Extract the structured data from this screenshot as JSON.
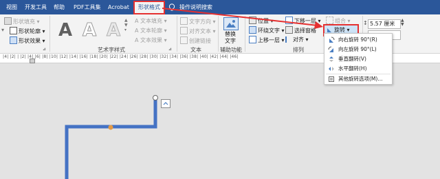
{
  "tabs": [
    "视图",
    "开发工具",
    "帮助",
    "PDF工具集",
    "Acrobat",
    "形状格式",
    "操作说明搜索"
  ],
  "shape_styles": {
    "fill": "形状填充",
    "outline": "形状轮廓",
    "effects": "形状效果"
  },
  "wordart": {
    "glyph": "A",
    "text_fill": "文本填充",
    "text_outline": "文本轮廓",
    "text_effects": "文本效果",
    "group_label": "艺术字样式"
  },
  "text_group": {
    "direction": "文字方向",
    "align": "对齐文本",
    "link": "创建链接",
    "group_label": "文本"
  },
  "accessibility": {
    "alt_text_line1": "替换",
    "alt_text_line2": "文字",
    "group_label": "辅助功能"
  },
  "arrange": {
    "position": "位置",
    "wrap": "环绕文字",
    "bring_forward": "上移一层",
    "send_backward": "下移一层",
    "selection_pane": "选择窗格",
    "align": "对齐",
    "group": "组合",
    "rotate": "旋转",
    "group_label": "排列"
  },
  "size": {
    "height": "5.57 厘米"
  },
  "rotate_menu": [
    "向右旋转 90°(R)",
    "向左旋转 90°(L)",
    "垂直翻转(V)",
    "水平翻转(H)",
    "其他旋转选项(M)..."
  ],
  "ruler": "|4|  |2|  |  |2|  |4|  |6|  |8|  |10|  |12|  |14|  |16|  |18|  |20|  |22|  |24|  |26|  |28|  |30|  |32|  |34|  |36|  |38|  |40|  |42|  |44|  |46|",
  "colors": {
    "accent": "#2b579a",
    "highlight": "#e53030",
    "shape_line": "#4472c4",
    "handle": "#e39a45"
  }
}
